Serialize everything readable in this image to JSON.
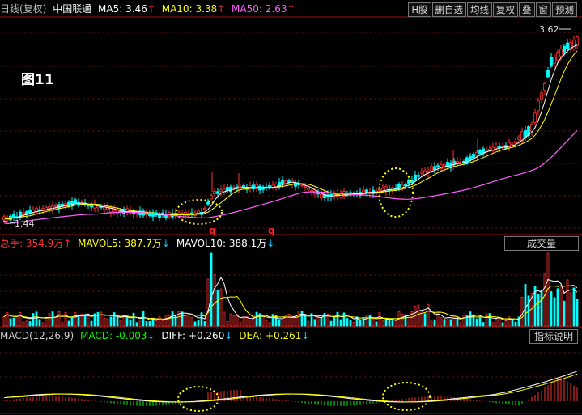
{
  "top_bar": {
    "period": "日线(复权)",
    "stock": "中国联通",
    "ma5": {
      "label": "MA5:",
      "value": "3.46",
      "trend": "↑",
      "color": "#ffffff"
    },
    "ma10": {
      "label": "MA10:",
      "value": "3.38",
      "trend": "↑",
      "color": "#ffff00"
    },
    "ma50": {
      "label": "MA50:",
      "value": "2.63",
      "trend": "↑",
      "color": "#ff60ff"
    },
    "buttons": [
      "H股",
      "删自选",
      "均线",
      "复权",
      "叠",
      "窗",
      "预测"
    ]
  },
  "figure_label": "图11",
  "price": {
    "high_label": "3.62",
    "low_label": "1.44",
    "markers": [
      "q",
      "q"
    ]
  },
  "volume": {
    "total": {
      "label": "总手:",
      "value": "354.9万",
      "trend": "↑"
    },
    "mavol5": {
      "label": "MAVOL5:",
      "value": "387.7万",
      "trend": "↓"
    },
    "mavol10": {
      "label": "MAVOL10:",
      "value": "388.1万",
      "trend": "↓"
    },
    "dropdown": "成交量"
  },
  "macd": {
    "name": "MACD(12,26,9)",
    "macd": {
      "label": "MACD:",
      "value": "-0.003",
      "trend": "↓"
    },
    "diff": {
      "label": "DIFF:",
      "value": "+0.260",
      "trend": "↓"
    },
    "dea": {
      "label": "DEA:",
      "value": "+0.261",
      "trend": "↓"
    },
    "help_button": "指标说明"
  },
  "colors": {
    "up": "#ff3030",
    "down": "#00ffff",
    "ma5": "#ffffff",
    "ma10": "#ffff00",
    "ma50": "#ff60ff",
    "grid": "#8a1010",
    "highlight": "#ffff00"
  }
}
